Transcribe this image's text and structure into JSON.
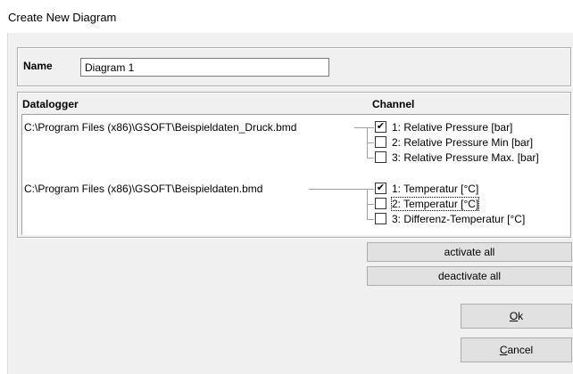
{
  "window": {
    "title": "Create New Diagram"
  },
  "name_group": {
    "label": "Name",
    "value": "Diagram 1"
  },
  "datalogger": {
    "header_datalogger": "Datalogger",
    "header_channel": "Channel",
    "loggers": [
      {
        "path": "C:\\Program Files (x86)\\GSOFT\\Beispieldaten_Druck.bmd",
        "channels": [
          {
            "label": "1: Relative Pressure [bar]",
            "checked": true
          },
          {
            "label": "2: Relative Pressure Min [bar]",
            "checked": false
          },
          {
            "label": "3: Relative Pressure Max. [bar]",
            "checked": false
          }
        ]
      },
      {
        "path": "C:\\Program Files (x86)\\GSOFT\\Beispieldaten.bmd",
        "channels": [
          {
            "label": "1: Temperatur [°C]",
            "checked": true
          },
          {
            "label": "2: Temperatur [°C]",
            "checked": false,
            "focused": true
          },
          {
            "label": "3: Differenz-Temperatur [°C]",
            "checked": false
          }
        ]
      }
    ]
  },
  "buttons": {
    "activate_all": "activate all",
    "deactivate_all": "deactivate all",
    "ok_first": "O",
    "ok_rest": "k",
    "cancel_first": "C",
    "cancel_rest": "ancel"
  },
  "colors": {
    "dialog_bg": "#f0f0f0",
    "button_bg": "#e1e1e1",
    "border": "#adadad"
  }
}
